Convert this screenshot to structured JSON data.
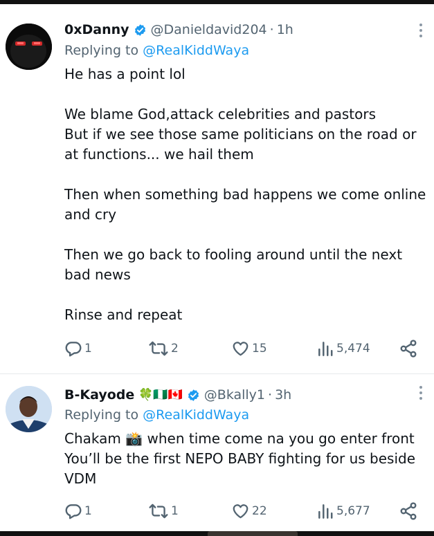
{
  "tweets": [
    {
      "name": "0xDanny",
      "handle": "@Danieldavid204",
      "separator": "·",
      "time": "1h",
      "replying_prefix": "Replying to",
      "replying_to": "@RealKiddWaya",
      "paragraphs": [
        "He has a point lol",
        "We blame God,attack celebrities and pastors\nBut if we see those same politicians on the road or at functions... we hail them",
        "Then when something bad happens we come online and cry",
        "Then we go back to fooling around until the next bad news",
        "Rinse and repeat"
      ],
      "stats": {
        "replies": "1",
        "reposts": "2",
        "likes": "15",
        "views": "5,474"
      }
    },
    {
      "name": "B-Kayode",
      "flags": "🍀🇳🇬🇨🇦",
      "handle": "@Bkally1",
      "separator": "·",
      "time": "3h",
      "replying_prefix": "Replying to",
      "replying_to": "@RealKiddWaya",
      "paragraphs": [
        "Chakam 📸 when time come na you go enter front\nYou’ll be the first NEPO BABY fighting for us beside VDM"
      ],
      "stats": {
        "replies": "1",
        "reposts": "1",
        "likes": "22",
        "views": "5,677"
      }
    }
  ],
  "colors": {
    "accent": "#1d9bf0",
    "muted": "#536471",
    "text": "#0f1419",
    "divider": "#e6e9eb"
  },
  "icons": [
    "verified-badge-icon",
    "more-icon",
    "reply-icon",
    "repost-icon",
    "like-icon",
    "views-icon",
    "share-icon"
  ]
}
